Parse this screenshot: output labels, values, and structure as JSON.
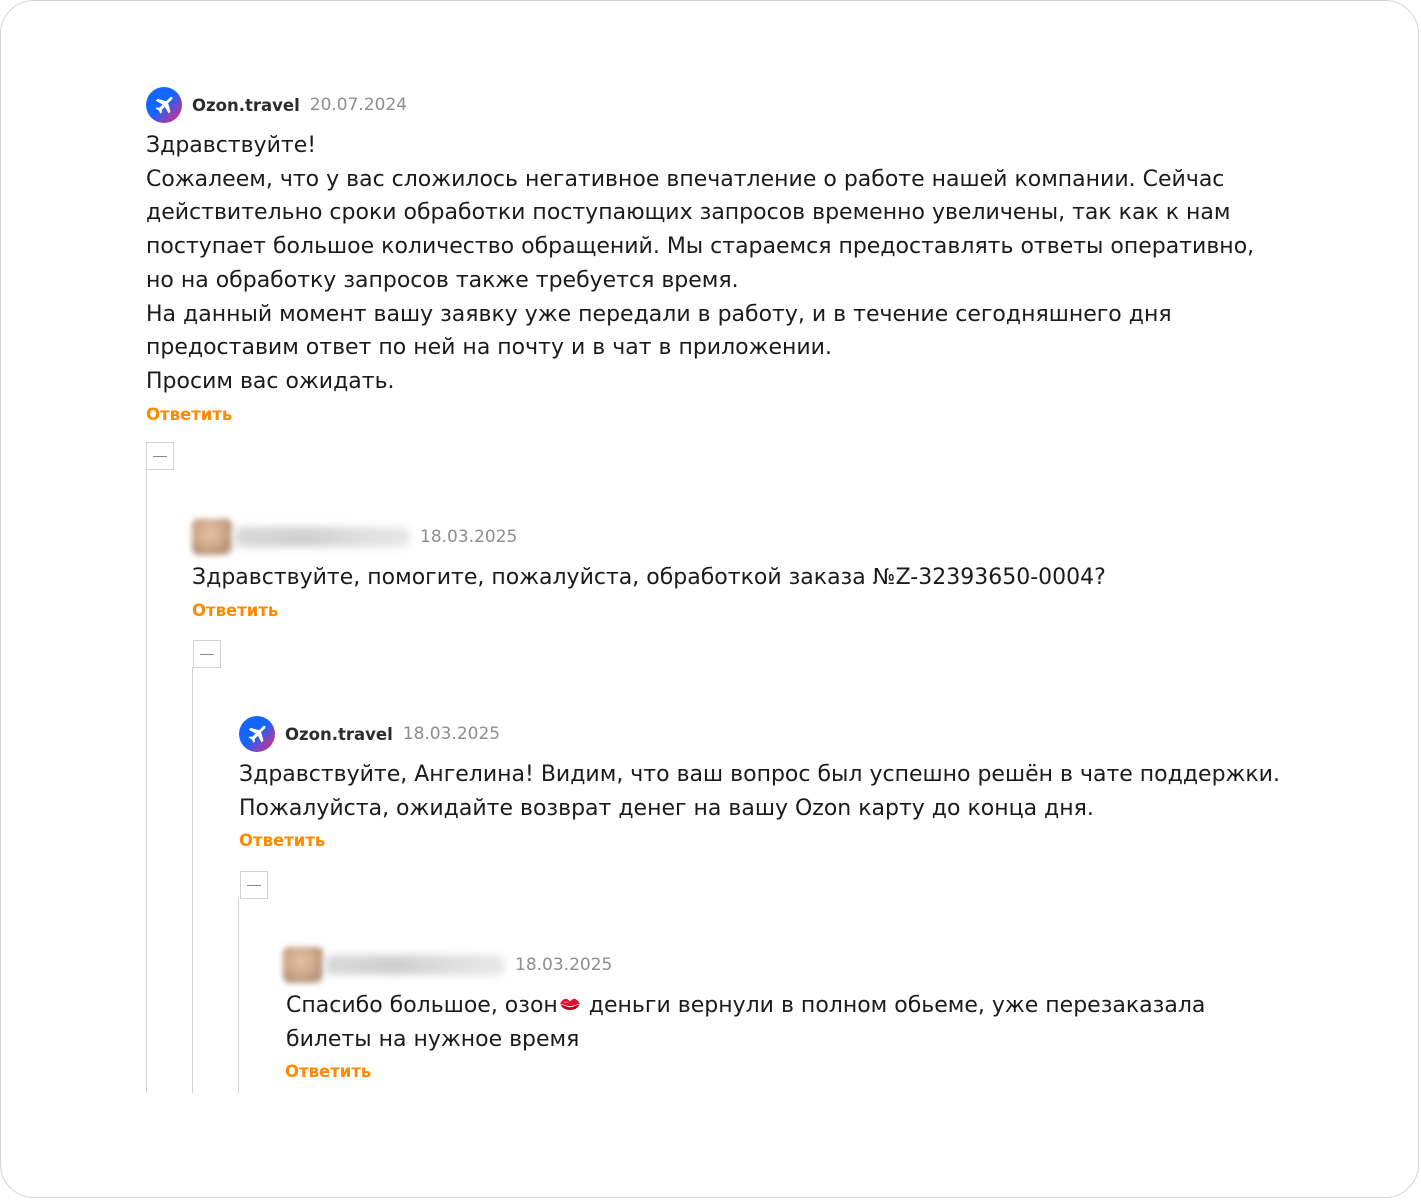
{
  "comments": [
    {
      "author": "Ozon.travel",
      "date": "20.07.2024",
      "lines": [
        "Здравствуйте!",
        "Сожалеем, что у вас сложилось негативное впечатление о работе нашей компании. Сейчас",
        "действительно сроки обработки поступающих запросов временно увеличены, так как к нам",
        "поступает большое количество обращений. Мы стараемся предоставлять ответы оперативно,",
        "но на обработку запросов также требуется время.",
        "На данный момент вашу заявку уже передали в работу, и в течение сегодняшнего дня",
        "предоставим ответ по ней на почту и в чат в приложении.",
        "Просим вас ожидать."
      ],
      "reply_label": "Ответить",
      "avatar_icon": "airplane-icon"
    },
    {
      "author": "",
      "date": "18.03.2025",
      "lines": [
        "Здравствуйте, помогите, пожалуйста, обработкой заказа №Z-32393650-0004?"
      ],
      "reply_label": "Ответить"
    },
    {
      "author": "Ozon.travel",
      "date": "18.03.2025",
      "lines": [
        "Здравствуйте, Ангелина! Видим, что ваш вопрос был успешно решён в чате поддержки.",
        "Пожалуйста, ожидайте возврат денег на вашу Ozon карту до конца дня."
      ],
      "reply_label": "Ответить",
      "avatar_icon": "airplane-icon"
    },
    {
      "author": "",
      "date": "18.03.2025",
      "line1_before_emoji": "Спасибо большое, озон",
      "emoji": "kiss-mark-icon",
      "line1_after_emoji": " деньги вернули в полном обьеме, уже перезаказала",
      "line2": "билеты на нужное время",
      "reply_label": "Ответить"
    }
  ],
  "colors": {
    "accent": "#ff8a00",
    "brand_blue": "#1565ff",
    "brand_pink": "#ff1f6b",
    "date_gray": "#8e8e8e"
  }
}
